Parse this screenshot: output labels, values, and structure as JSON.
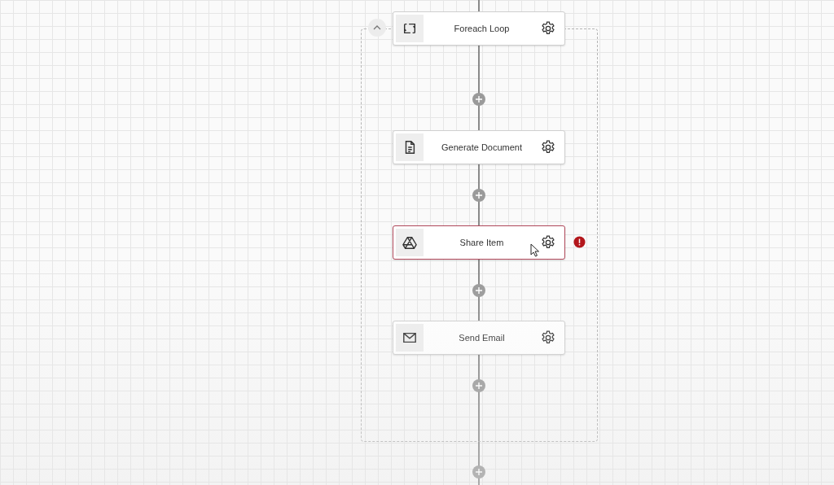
{
  "loop": {
    "label": "Foreach Loop",
    "kind": "loop",
    "expanded": true,
    "error": false,
    "children": [
      {
        "label": "Generate Document",
        "kind": "document",
        "error": false
      },
      {
        "label": "Share Item",
        "kind": "drive",
        "error": true
      },
      {
        "label": "Send Email",
        "kind": "email",
        "error": false
      }
    ]
  }
}
